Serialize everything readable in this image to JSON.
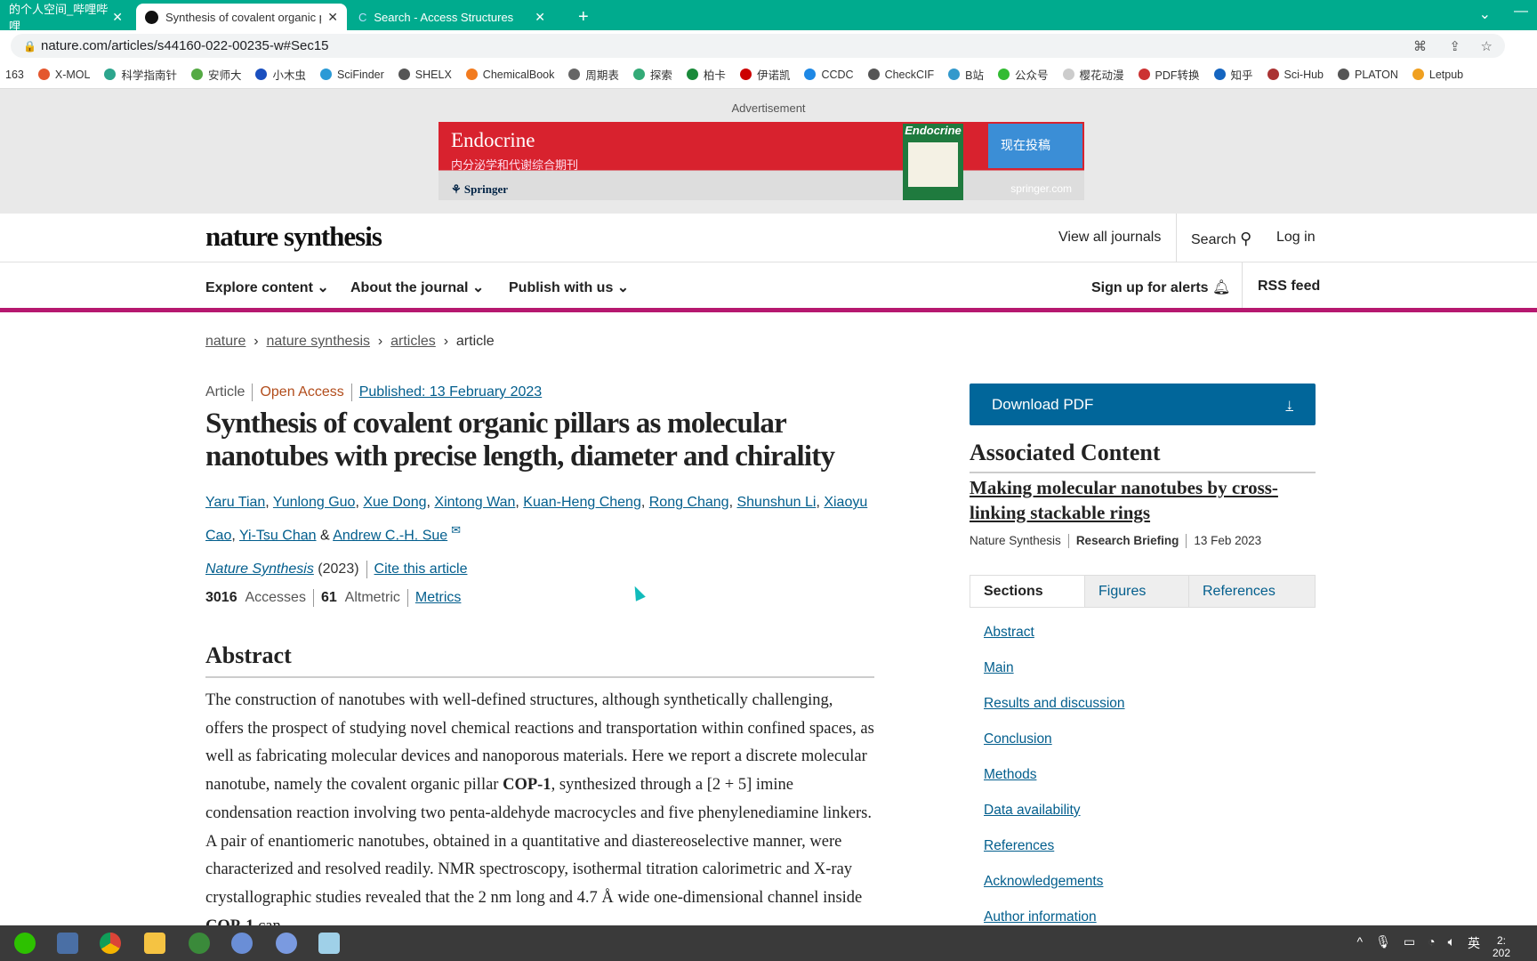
{
  "browser": {
    "tabs": [
      {
        "title": "的个人空间_哔哩哔哩_",
        "active": false
      },
      {
        "title": "Synthesis of covalent organic p",
        "active": true
      },
      {
        "title": "Search - Access Structures",
        "active": false
      }
    ],
    "new_tab": "+",
    "url": "nature.com/articles/s44160-022-00235-w#Sec15",
    "bookmarks": [
      "163",
      "X-MOL",
      "科学指南针",
      "安师大",
      "小木虫",
      "SciFinder",
      "SHELX",
      "ChemicalBook",
      "周期表",
      "探索",
      "柏卡",
      "伊诺凯",
      "CCDC",
      "CheckCIF",
      "B站",
      "公众号",
      "樱花动漫",
      "PDF转换",
      "知乎",
      "Sci-Hub",
      "PLATON",
      "Letpub"
    ],
    "theme_color": "#00ab8e"
  },
  "ad": {
    "label": "Advertisement",
    "title": "Endocrine",
    "subtitle": "内分泌学和代谢综合期刊",
    "publisher": "Springer",
    "cover": "Endocrine",
    "cta": "现在投稿",
    "site": "springer.com"
  },
  "header": {
    "logo": "nature synthesis",
    "view_all": "View all journals",
    "search": "Search",
    "login": "Log in"
  },
  "nav": {
    "items": [
      "Explore content",
      "About the journal",
      "Publish with us"
    ],
    "alerts": "Sign up for alerts",
    "rss": "RSS feed",
    "accent": "#b6186f"
  },
  "breadcrumb": [
    "nature",
    "nature synthesis",
    "articles",
    "article"
  ],
  "article": {
    "type": "Article",
    "access": "Open Access",
    "published": "Published: 13 February 2023",
    "title": "Synthesis of covalent organic pillars as molecular nanotubes with precise length, diameter and chirality",
    "authors": [
      "Yaru Tian",
      "Yunlong Guo",
      "Xue Dong",
      "Xintong Wan",
      "Kuan-Heng Cheng",
      "Rong Chang",
      "Shunshun Li",
      "Xiaoyu Cao",
      "Yi-Tsu Chan",
      "Andrew C.-H. Sue"
    ],
    "journal": "Nature Synthesis",
    "year": "(2023)",
    "cite": "Cite this article",
    "accesses": "3016",
    "accesses_label": "Accesses",
    "altmetric": "61",
    "altmetric_label": "Altmetric",
    "metrics": "Metrics",
    "abstract_heading": "Abstract",
    "abstract": "The construction of nanotubes with well-defined structures, although synthetically challenging, offers the prospect of studying novel chemical reactions and transportation within confined spaces, as well as fabricating molecular devices and nanoporous materials. Here we report a discrete molecular nanotube, namely the covalent organic pillar COP-1, synthesized through a [2 + 5] imine condensation reaction involving two penta-aldehyde macrocycles and five phenylenediamine linkers. A pair of enantiomeric nanotubes, obtained in a quantitative and diastereoselective manner, were characterized and resolved readily. NMR spectroscopy, isothermal titration calorimetric and X-ray crystallographic studies revealed that the 2 nm long and 4.7 Å wide one-dimensional channel inside COP-1 can"
  },
  "sidebar": {
    "download": "Download PDF",
    "assoc_heading": "Associated Content",
    "assoc_title": "Making molecular nanotubes by cross-linking stackable rings",
    "assoc_journal": "Nature Synthesis",
    "assoc_type": "Research Briefing",
    "assoc_date": "13 Feb 2023",
    "tabs": [
      "Sections",
      "Figures",
      "References"
    ],
    "sections": [
      "Abstract",
      "Main",
      "Results and discussion",
      "Conclusion",
      "Methods",
      "Data availability",
      "References",
      "Acknowledgements",
      "Author information"
    ]
  },
  "taskbar": {
    "ime": "英",
    "time": "2:",
    "date": "202"
  }
}
